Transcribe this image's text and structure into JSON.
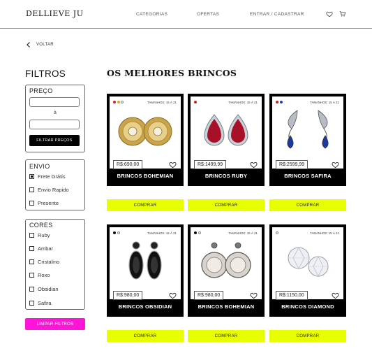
{
  "header": {
    "brand": "DELLIEVE JU",
    "nav": [
      "CATEGORIAS",
      "OFERTAS",
      "ENTRAR / CADASTRAR"
    ],
    "icons": [
      "heart-icon",
      "cart-icon"
    ]
  },
  "back": {
    "label": "VOLTAR",
    "icon": "chevron-left-icon"
  },
  "filters": {
    "title": "FILTROS",
    "price": {
      "title": "PREÇO",
      "min_value": "",
      "separator": "à",
      "max_value": "",
      "button": "FILTRAR PREÇOS"
    },
    "shipping": {
      "title": "ENVIO",
      "options": [
        {
          "label": "Frete Grátis",
          "checked": true
        },
        {
          "label": "Envio Rapido",
          "checked": false
        },
        {
          "label": "Presente",
          "checked": false
        }
      ]
    },
    "colors": {
      "title": "CORES",
      "options": [
        {
          "label": "Ruby",
          "checked": false
        },
        {
          "label": "Ambar",
          "checked": false
        },
        {
          "label": "Cristalino",
          "checked": false
        },
        {
          "label": "Roxo",
          "checked": false
        },
        {
          "label": "Obsidian",
          "checked": false
        },
        {
          "label": "Safira",
          "checked": false
        }
      ]
    },
    "clear_button": "LIMPAR FILTROS"
  },
  "main": {
    "title": "OS MELHORES BRINCOS",
    "products": [
      {
        "name": "BRINCOS BOHEMIAN",
        "price": "R$:690,00",
        "sizes": "TAMANHOS: 15 À 21",
        "dots": [
          "#d42020",
          "#e8a020",
          "#ffffff"
        ],
        "buy": "COMPRAR"
      },
      {
        "name": "BRINCOS RUBY",
        "price": "R$:1499,99",
        "sizes": "TAMANHOS: 15 À 21",
        "dots": [
          "#d42020"
        ],
        "buy": "COMPRAR"
      },
      {
        "name": "BRINCOS SAFIRA",
        "price": "R$:2599,99",
        "sizes": "TAMANHOS: 15 À 21",
        "dots": [
          "#d42020",
          "#2040c0"
        ],
        "buy": "COMPRAR"
      },
      {
        "name": "BRINCOS OBSIDIAN",
        "price": "R$:980,00",
        "sizes": "TAMANHOS: 15 À 21",
        "dots": [
          "#111111",
          "#ffffff"
        ],
        "buy": "COMPRAR"
      },
      {
        "name": "BRINCOS BOHEMIAN",
        "price": "R$:980,00",
        "sizes": "TAMANHOS: 15 À 21",
        "dots": [
          "#111111",
          "#ffffff"
        ],
        "buy": "COMPRAR"
      },
      {
        "name": "BRINCOS DIAMOND",
        "price": "R$:1150,00",
        "sizes": "TAMANHOS: 15 À 21",
        "dots": [
          "#ffffff"
        ],
        "buy": "COMPRAR"
      }
    ]
  },
  "colors": {
    "accent_buy": "#e8ff00",
    "accent_clear": "#ff14d8",
    "card_bg": "#000000"
  }
}
